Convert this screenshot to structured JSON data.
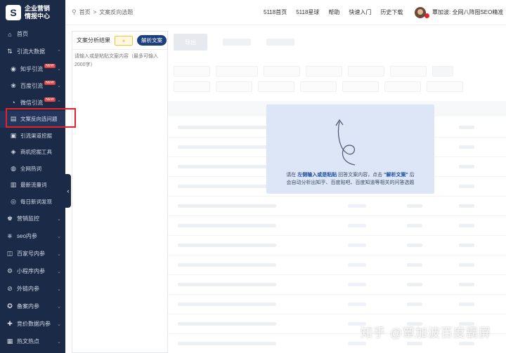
{
  "brand": {
    "line1": "企业营销",
    "line2": "情报中心",
    "mark": "S"
  },
  "sidebar": {
    "items": [
      {
        "label": "首页",
        "icon": "home-icon",
        "glyph": "⌂",
        "level": 0
      },
      {
        "label": "引流大数据",
        "icon": "traffic-icon",
        "glyph": "⇅",
        "level": 0,
        "chevron": "⌃"
      },
      {
        "label": "知乎引流",
        "icon": "zhihu-icon",
        "glyph": "◉",
        "level": 1,
        "badge": "NEW",
        "chevron": "⌄"
      },
      {
        "label": "百度引流",
        "icon": "baidu-icon",
        "glyph": "❀",
        "level": 1,
        "badge": "NEW",
        "chevron": "⌄"
      },
      {
        "label": "微信引流",
        "icon": "wechat-icon",
        "glyph": "◔",
        "level": 1,
        "badge": "NEW",
        "chevron": "⌃"
      },
      {
        "label": "文案反向选问题",
        "icon": "document-icon",
        "glyph": "▤",
        "level": 2,
        "active": true
      },
      {
        "label": "引流渠道挖掘",
        "icon": "channel-icon",
        "glyph": "▣",
        "level": 2
      },
      {
        "label": "商机挖掘工具",
        "icon": "opportunity-icon",
        "glyph": "◈",
        "level": 2
      },
      {
        "label": "全网热词",
        "icon": "hotword-icon",
        "glyph": "◍",
        "level": 2
      },
      {
        "label": "最新流量词",
        "icon": "newword-icon",
        "glyph": "▥",
        "level": 2
      },
      {
        "label": "每日新词发现",
        "icon": "discover-icon",
        "glyph": "◎",
        "level": 2
      },
      {
        "label": "营销监控",
        "icon": "monitor-icon",
        "glyph": "♚",
        "level": 0,
        "chevron": "⌄"
      },
      {
        "label": "seo内参",
        "icon": "seo-icon",
        "glyph": "⎈",
        "level": 0,
        "chevron": "⌄"
      },
      {
        "label": "百家号内参",
        "icon": "baijiahao-icon",
        "glyph": "◫",
        "level": 0,
        "chevron": "⌄"
      },
      {
        "label": "小程序内参",
        "icon": "miniprogram-icon",
        "glyph": "⚙",
        "level": 0,
        "chevron": "⌄"
      },
      {
        "label": "外链内参",
        "icon": "link-icon",
        "glyph": "⊘",
        "level": 0,
        "chevron": "⌄"
      },
      {
        "label": "备案内参",
        "icon": "record-icon",
        "glyph": "✪",
        "level": 0,
        "chevron": "⌄"
      },
      {
        "label": "竞价数据内参",
        "icon": "bidding-icon",
        "glyph": "✚",
        "level": 0,
        "chevron": "⌄"
      },
      {
        "label": "热文热点",
        "icon": "hotarticle-icon",
        "glyph": "▦",
        "level": 0,
        "chevron": "⌄"
      }
    ],
    "collapse_glyph": "‹"
  },
  "topbar": {
    "breadcrumb": [
      "首页",
      "文案反向选题"
    ],
    "breadcrumb_separator": ">",
    "nav": [
      "5118首页",
      "5118星球",
      "帮助",
      "快速入门",
      "历史下载"
    ],
    "user_text": "覃加波: 全网八阵图SEO精准"
  },
  "panel": {
    "title": "文案分析结果",
    "small_button_glyph": "⁎",
    "parse_button": "解析文案",
    "placeholder": "请输入或是粘贴文案内容（最多可输入2000字）"
  },
  "main": {
    "export_label": "导出"
  },
  "hint": {
    "prefix": "请在 ",
    "link1": "左侧输入或是粘贴",
    "middle": " 回答文案内容，点击 ",
    "link2": "\"解析文案\"",
    "suffix": " 后",
    "line2": "会自动分析出知乎、百度贴吧、百度知道等相关的问答选题"
  },
  "watermark": "知乎 @覃加波百度霸屏"
}
